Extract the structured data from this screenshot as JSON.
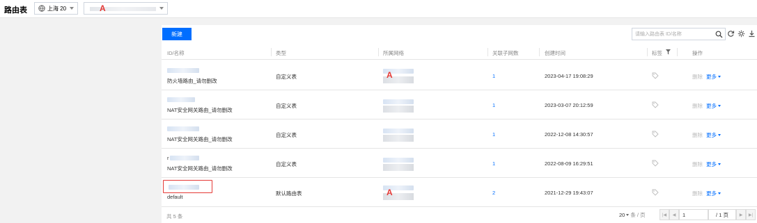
{
  "header": {
    "title": "路由表",
    "region_label": "上海 20",
    "vpc_mark": "A"
  },
  "toolbar": {
    "new_label": "新建",
    "search_placeholder": "请输入路由表 ID/名称"
  },
  "columns": [
    "ID/名称",
    "类型",
    "所属网络",
    "关联子网数",
    "创建时间",
    "标签",
    "操作"
  ],
  "rows": [
    {
      "name": "防火墙路由_请勿删改",
      "type": "自定义表",
      "network_mark": "A",
      "subnets": "1",
      "created": "2023-04-17 19:08:29",
      "delete": "删除",
      "more": "更多"
    },
    {
      "name": "NAT安全网关路由_请勿删改",
      "type": "自定义表",
      "network_mark": "",
      "subnets": "1",
      "created": "2023-03-07 20:12:59",
      "delete": "删除",
      "more": "更多"
    },
    {
      "name": "NAT安全网关路由_请勿删改",
      "type": "自定义表",
      "network_mark": "",
      "subnets": "1",
      "created": "2022-12-08 14:30:57",
      "delete": "删除",
      "more": "更多"
    },
    {
      "name": "NAT安全网关路由_请勿删改",
      "type": "自定义表",
      "network_mark": "",
      "subnets": "1",
      "created": "2022-08-09 16:29:51",
      "delete": "删除",
      "more": "更多",
      "id_prefix": "r"
    },
    {
      "name": "default",
      "type": "默认路由表",
      "network_mark": "A",
      "subnets": "2",
      "created": "2021-12-29 19:43:07",
      "delete": "删除",
      "more": "更多"
    }
  ],
  "footer": {
    "total": "共 5 条",
    "page_size": "20",
    "page_size_unit": "条 / 页",
    "current_page": "1",
    "total_pages": "/ 1 页"
  }
}
